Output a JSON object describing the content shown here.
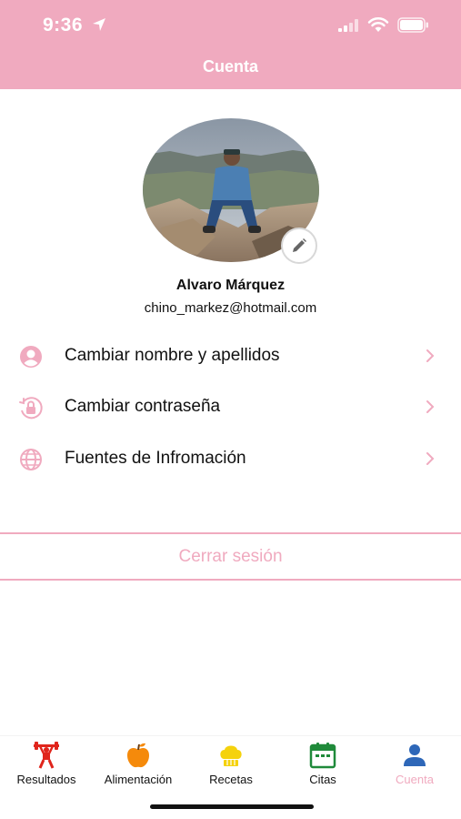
{
  "status_bar": {
    "time": "9:36"
  },
  "header": {
    "title": "Cuenta"
  },
  "profile": {
    "name": "Alvaro Márquez",
    "email": "chino_markez@hotmail.com"
  },
  "menu": [
    {
      "label": "Cambiar nombre y apellidos",
      "icon": "user-circle-icon"
    },
    {
      "label": "Cambiar contraseña",
      "icon": "lock-refresh-icon"
    },
    {
      "label": "Fuentes de Infromación",
      "icon": "globe-icon"
    }
  ],
  "logout": {
    "label": "Cerrar sesión"
  },
  "tabs": [
    {
      "label": "Resultados",
      "icon": "weightlifter-icon",
      "color": "#e0251c"
    },
    {
      "label": "Alimentación",
      "icon": "apple-icon",
      "color": "#f58a0b"
    },
    {
      "label": "Recetas",
      "icon": "chef-hat-icon",
      "color": "#f5d20c"
    },
    {
      "label": "Citas",
      "icon": "calendar-icon",
      "color": "#1f8a3a"
    },
    {
      "label": "Cuenta",
      "icon": "person-icon",
      "color": "#2e67b8",
      "active": true
    }
  ],
  "colors": {
    "accent": "#f0aabf",
    "active_tab_label": "#f0aabf"
  }
}
